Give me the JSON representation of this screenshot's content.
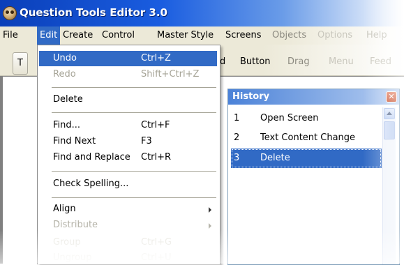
{
  "window": {
    "title": "Question Tools Editor 3.0"
  },
  "menubar": {
    "items": [
      "File",
      "Edit",
      "Create",
      "Control",
      "Master Style",
      "Screens",
      "Objects",
      "Options",
      "Help"
    ]
  },
  "toolbar": {
    "first_button": "T",
    "partial_char": "d",
    "items": [
      "Button",
      "Drag",
      "Menu",
      "Feed"
    ]
  },
  "edit_menu": {
    "items": [
      {
        "label": "Undo",
        "shortcut": "Ctrl+Z"
      },
      {
        "label": "Redo",
        "shortcut": "Shift+Ctrl+Z"
      },
      {
        "label": "Delete",
        "shortcut": ""
      },
      {
        "label": "Find...",
        "shortcut": "Ctrl+F"
      },
      {
        "label": "Find Next",
        "shortcut": "F3"
      },
      {
        "label": "Find and Replace",
        "shortcut": "Ctrl+R"
      },
      {
        "label": "Check Spelling...",
        "shortcut": ""
      },
      {
        "label": "Align",
        "shortcut": ""
      },
      {
        "label": "Distribute",
        "shortcut": ""
      },
      {
        "label": "Group",
        "shortcut": "Ctrl+G"
      },
      {
        "label": "Ungroup",
        "shortcut": "Ctrl+U"
      }
    ]
  },
  "history_panel": {
    "title": "History",
    "close_glyph": "✕",
    "entries": [
      {
        "num": "1",
        "text": "Open Screen"
      },
      {
        "num": "2",
        "text": "Text Content Change"
      },
      {
        "num": "3",
        "text": "Delete"
      }
    ],
    "selected_index": 2
  },
  "colors": {
    "selection": "#316ac5",
    "titlebar": "#0a3fb9",
    "menubar": "#ece9d8"
  }
}
